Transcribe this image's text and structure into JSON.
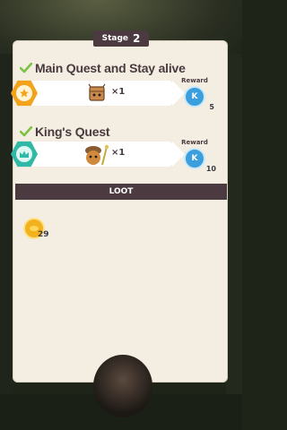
{
  "stage": {
    "label": "Stage",
    "number": "2"
  },
  "quests": [
    {
      "title": "Main Quest and Stay alive",
      "icon": "star-icon",
      "item": "crate-creature-icon",
      "quantity": "×1",
      "reward_label": "Reward",
      "reward_token": "K",
      "reward_count": "5",
      "hex_color": "#f2a31b"
    },
    {
      "title": "King's Quest",
      "icon": "crown-icon",
      "item": "acorn-warrior-icon",
      "quantity": "×1",
      "reward_label": "Reward",
      "reward_token": "K",
      "reward_count": "10",
      "hex_color": "#2fb9a6"
    }
  ],
  "loot": {
    "label": "LOOT",
    "items": [
      {
        "icon": "gold-coin-icon",
        "count": "29"
      }
    ]
  },
  "colors": {
    "panel": "#f4eee2",
    "header": "#4b3a3f",
    "check": "#7cc243",
    "reward_token": "#3c9fdd"
  }
}
